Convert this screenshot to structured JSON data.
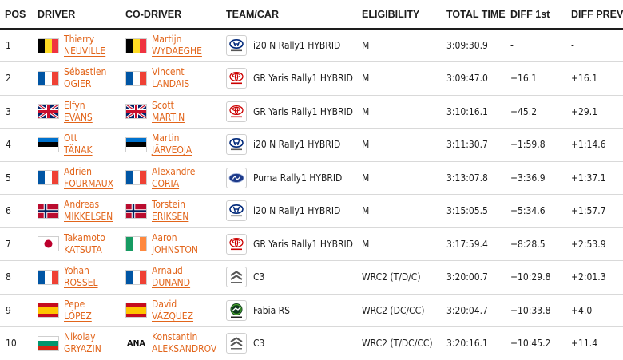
{
  "headers": {
    "pos": "POS",
    "driver": "DRIVER",
    "codriver": "CO-DRIVER",
    "team": "TEAM/CAR",
    "eligibility": "ELIGIBILITY",
    "total_time": "TOTAL TIME",
    "diff_first": "DIFF 1st",
    "diff_prev": "DIFF PREV"
  },
  "colors": {
    "name_accent": "#e2651b",
    "header_rule": "#1d1d1d",
    "row_rule": "#d9d9d9"
  },
  "flags": {
    "belgium-flag-icon": {
      "dir": "v",
      "colors": [
        "#000000",
        "#fdda24",
        "#ef3340"
      ]
    },
    "france-flag-icon": {
      "dir": "v",
      "colors": [
        "#0055a4",
        "#ffffff",
        "#ef4135"
      ]
    },
    "italy-flag-icon": {
      "dir": "v",
      "colors": [
        "#009246",
        "#ffffff",
        "#ce2b37"
      ]
    },
    "estonia-flag-icon": {
      "dir": "h",
      "colors": [
        "#0072ce",
        "#000000",
        "#ffffff"
      ]
    },
    "bulgaria-flag-icon": {
      "dir": "h",
      "colors": [
        "#ffffff",
        "#00966e",
        "#d62612"
      ]
    },
    "ireland-flag-icon": {
      "dir": "v",
      "colors": [
        "#169b62",
        "#ffffff",
        "#ff883e"
      ]
    },
    "spain-flag-icon": {
      "dir": "h",
      "colors": [
        "#c60b1e",
        "#ffc400",
        "#ffc400",
        "#c60b1e"
      ]
    }
  },
  "rows": [
    {
      "pos": "1",
      "driver": {
        "first": "Thierry",
        "last": "NEUVILLE",
        "flag": "belgium-flag-icon"
      },
      "codriver": {
        "first": "Martijn",
        "last": "WYDAEGHE",
        "flag": "belgium-flag-icon"
      },
      "logo": "hyundai-logo-icon",
      "car": "i20 N Rally1 HYBRID",
      "eligibility": "M",
      "time": "3:09:30.9",
      "diff_first": "-",
      "diff_prev": "-"
    },
    {
      "pos": "2",
      "driver": {
        "first": "Sébastien",
        "last": "OGIER",
        "flag": "france-flag-icon"
      },
      "codriver": {
        "first": "Vincent",
        "last": "LANDAIS",
        "flag": "france-flag-icon"
      },
      "logo": "toyota-logo-icon",
      "car": "GR Yaris Rally1 HYBRID",
      "eligibility": "M",
      "time": "3:09:47.0",
      "diff_first": "+16.1",
      "diff_prev": "+16.1"
    },
    {
      "pos": "3",
      "driver": {
        "first": "Elfyn",
        "last": "EVANS",
        "flag": "uk-flag-icon"
      },
      "codriver": {
        "first": "Scott",
        "last": "MARTIN",
        "flag": "uk-flag-icon"
      },
      "logo": "toyota-logo-icon",
      "car": "GR Yaris Rally1 HYBRID",
      "eligibility": "M",
      "time": "3:10:16.1",
      "diff_first": "+45.2",
      "diff_prev": "+29.1"
    },
    {
      "pos": "4",
      "driver": {
        "first": "Ott",
        "last": "TÄNAK",
        "flag": "estonia-flag-icon"
      },
      "codriver": {
        "first": "Martin",
        "last": "JÄRVEOJA",
        "flag": "estonia-flag-icon"
      },
      "logo": "hyundai-logo-icon",
      "car": "i20 N Rally1 HYBRID",
      "eligibility": "M",
      "time": "3:11:30.7",
      "diff_first": "+1:59.8",
      "diff_prev": "+1:14.6"
    },
    {
      "pos": "5",
      "driver": {
        "first": "Adrien",
        "last": "FOURMAUX",
        "flag": "france-flag-icon"
      },
      "codriver": {
        "first": "Alexandre",
        "last": "CORIA",
        "flag": "france-flag-icon"
      },
      "logo": "ford-logo-icon",
      "car": "Puma Rally1 HYBRID",
      "eligibility": "M",
      "time": "3:13:07.8",
      "diff_first": "+3:36.9",
      "diff_prev": "+1:37.1"
    },
    {
      "pos": "6",
      "driver": {
        "first": "Andreas",
        "last": "MIKKELSEN",
        "flag": "norway-flag-icon"
      },
      "codriver": {
        "first": "Torstein",
        "last": "ERIKSEN",
        "flag": "norway-flag-icon"
      },
      "logo": "hyundai-logo-icon",
      "car": "i20 N Rally1 HYBRID",
      "eligibility": "M",
      "time": "3:15:05.5",
      "diff_first": "+5:34.6",
      "diff_prev": "+1:57.7"
    },
    {
      "pos": "7",
      "driver": {
        "first": "Takamoto",
        "last": "KATSUTA",
        "flag": "japan-flag-icon"
      },
      "codriver": {
        "first": "Aaron",
        "last": "JOHNSTON",
        "flag": "ireland-flag-icon"
      },
      "logo": "toyota-logo-icon",
      "car": "GR Yaris Rally1 HYBRID",
      "eligibility": "M",
      "time": "3:17:59.4",
      "diff_first": "+8:28.5",
      "diff_prev": "+2:53.9"
    },
    {
      "pos": "8",
      "driver": {
        "first": "Yohan",
        "last": "ROSSEL",
        "flag": "france-flag-icon"
      },
      "codriver": {
        "first": "Arnaud",
        "last": "DUNAND",
        "flag": "france-flag-icon"
      },
      "logo": "citroen-logo-icon",
      "car": "C3",
      "eligibility": "WRC2 (T/D/C)",
      "time": "3:20:00.7",
      "diff_first": "+10:29.8",
      "diff_prev": "+2:01.3"
    },
    {
      "pos": "9",
      "driver": {
        "first": "Pepe",
        "last": "LÓPEZ",
        "flag": "spain-flag-icon"
      },
      "codriver": {
        "first": "David",
        "last": "VÁZQUEZ",
        "flag": "spain-flag-icon"
      },
      "logo": "skoda-logo-icon",
      "car": "Fabia RS",
      "eligibility": "WRC2 (DC/CC)",
      "time": "3:20:04.7",
      "diff_first": "+10:33.8",
      "diff_prev": "+4.0"
    },
    {
      "pos": "10",
      "driver": {
        "first": "Nikolay",
        "last": "GRYAZIN",
        "flag": "bulgaria-flag-icon"
      },
      "codriver": {
        "first": "Konstantin",
        "last": "ALEKSANDROV",
        "flag": "text",
        "flag_text": "ANA"
      },
      "logo": "citroen-logo-icon",
      "car": "C3",
      "eligibility": "WRC2 (T/DC/CC)",
      "time": "3:20:16.1",
      "diff_first": "+10:45.2",
      "diff_prev": "+11.4"
    }
  ]
}
